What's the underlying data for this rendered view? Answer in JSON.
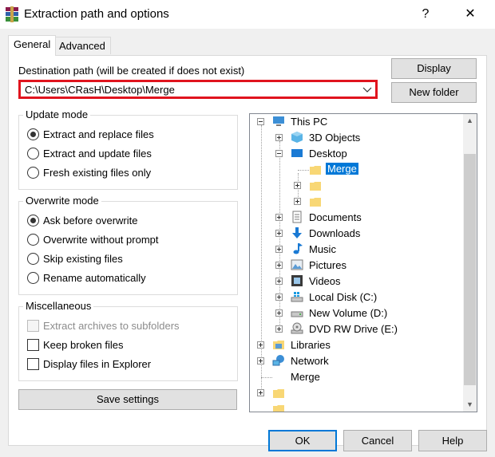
{
  "window": {
    "title": "Extraction path and options",
    "help_glyph": "?",
    "close_glyph": "✕"
  },
  "tabs": [
    {
      "label": "General",
      "active": true
    },
    {
      "label": "Advanced",
      "active": false
    }
  ],
  "destination": {
    "label": "Destination path (will be created if does not exist)",
    "value": "C:\\Users\\CRasH\\Desktop\\Merge"
  },
  "buttons": {
    "display": "Display",
    "new_folder": "New folder",
    "save_settings": "Save settings",
    "ok": "OK",
    "cancel": "Cancel",
    "help": "Help"
  },
  "update_mode": {
    "title": "Update mode",
    "options": [
      {
        "label": "Extract and replace files",
        "checked": true
      },
      {
        "label": "Extract and update files",
        "checked": false
      },
      {
        "label": "Fresh existing files only",
        "checked": false
      }
    ]
  },
  "overwrite_mode": {
    "title": "Overwrite mode",
    "options": [
      {
        "label": "Ask before overwrite",
        "checked": true
      },
      {
        "label": "Overwrite without prompt",
        "checked": false
      },
      {
        "label": "Skip existing files",
        "checked": false
      },
      {
        "label": "Rename automatically",
        "checked": false
      }
    ]
  },
  "miscellaneous": {
    "title": "Miscellaneous",
    "options": [
      {
        "label": "Extract archives to subfolders",
        "checked": false,
        "disabled": true
      },
      {
        "label": "Keep broken files",
        "checked": false,
        "disabled": false
      },
      {
        "label": "Display files in Explorer",
        "checked": false,
        "disabled": false
      }
    ]
  },
  "tree": {
    "this_pc": "This PC",
    "objects_3d": "3D Objects",
    "desktop": "Desktop",
    "merge_selected": "Merge",
    "documents": "Documents",
    "downloads": "Downloads",
    "music": "Music",
    "pictures": "Pictures",
    "videos": "Videos",
    "local_disk": "Local Disk (C:)",
    "new_volume": "New Volume (D:)",
    "dvd": "DVD RW Drive (E:)",
    "libraries": "Libraries",
    "network": "Network",
    "merge_root": "Merge",
    "scroll_up": "▲",
    "scroll_down": "▼"
  },
  "colors": {
    "highlight": "#e0141e",
    "selection": "#0078d7",
    "folder": "#f8d775"
  }
}
